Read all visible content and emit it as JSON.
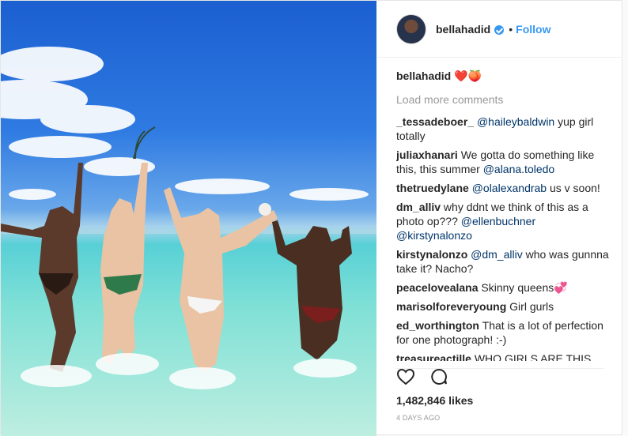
{
  "post": {
    "username": "bellahadid",
    "dot": "•",
    "follow_label": "Follow",
    "caption_user": "bellahadid",
    "caption_text": " ❤️🍑",
    "load_more": "Load more comments",
    "comments": [
      {
        "user": "_tessadeboer_",
        "parts": [
          {
            "t": " "
          },
          {
            "m": "@haileybaldwin"
          },
          {
            "t": " yup girl totally"
          }
        ]
      },
      {
        "user": "juliaxhanari",
        "parts": [
          {
            "t": " We gotta do something like this, this summer "
          },
          {
            "m": "@alana.toledo"
          }
        ]
      },
      {
        "user": "thetruedylane",
        "parts": [
          {
            "t": " "
          },
          {
            "m": "@olalexandrab"
          },
          {
            "t": " us v soon!"
          }
        ]
      },
      {
        "user": "dm_alliv",
        "parts": [
          {
            "t": " why ddnt we think of this as a photo op??? "
          },
          {
            "m": "@ellenbuchner"
          },
          {
            "t": " "
          },
          {
            "m": "@kirstynalonzo"
          }
        ]
      },
      {
        "user": "kirstynalonzo",
        "parts": [
          {
            "t": " "
          },
          {
            "m": "@dm_alliv"
          },
          {
            "t": " who was gunnna take it? Nacho?"
          }
        ]
      },
      {
        "user": "peacelovealana",
        "parts": [
          {
            "t": " Skinny queens💞"
          }
        ]
      },
      {
        "user": "marisolforeveryoung",
        "parts": [
          {
            "t": " Girl gurls"
          }
        ]
      },
      {
        "user": "ed_worthington",
        "parts": [
          {
            "t": " That is a lot of perfection for one photograph! :-)"
          }
        ]
      },
      {
        "user": "treasureactille",
        "parts": [
          {
            "t": " WHO GIRLS ARE THIS ?!?!??!"
          }
        ]
      }
    ],
    "likes": "1,482,846 likes",
    "time": "4 DAYS AGO",
    "icons": {
      "like": "heart-icon",
      "comment": "comment-icon",
      "verified": "verified-badge-icon"
    }
  }
}
